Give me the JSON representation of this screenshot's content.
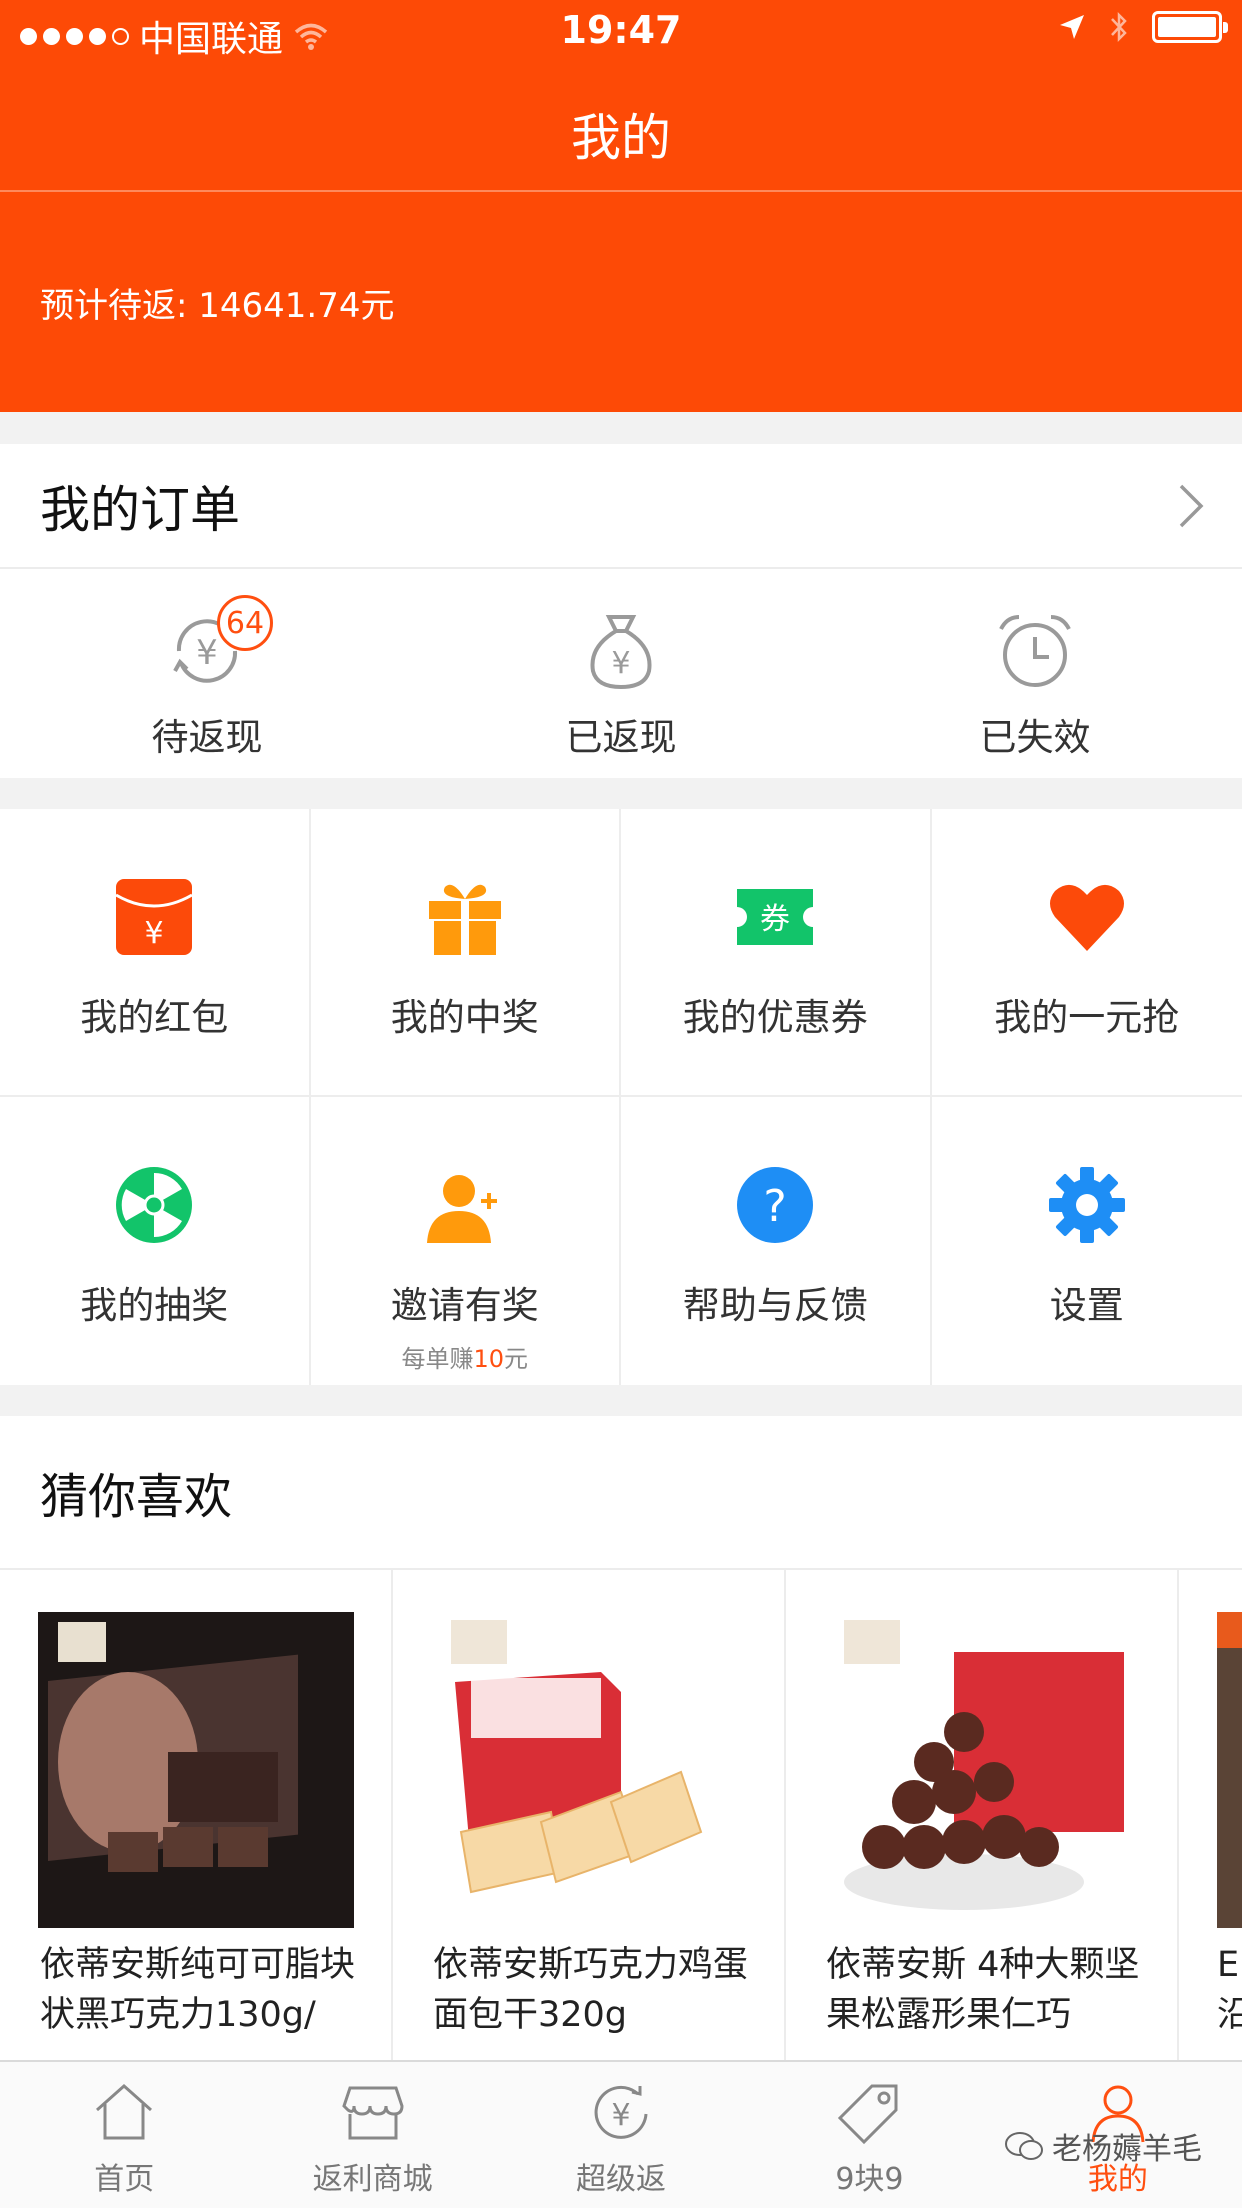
{
  "status_bar": {
    "carrier": "中国联通",
    "time": "19:47"
  },
  "nav": {
    "title": "我的"
  },
  "summary": {
    "pending_text": "预计待返: 14641.74元"
  },
  "orders": {
    "title": "我的订单",
    "items": [
      {
        "label": "待返现",
        "badge": "64"
      },
      {
        "label": "已返现"
      },
      {
        "label": "已失效"
      }
    ]
  },
  "grid": {
    "items": [
      {
        "label": "我的红包"
      },
      {
        "label": "我的中奖"
      },
      {
        "label": "我的优惠券",
        "icon_text": "券"
      },
      {
        "label": "我的一元抢"
      },
      {
        "label": "我的抽奖"
      },
      {
        "label": "邀请有奖",
        "sub_prefix": "每单赚",
        "sub_highlight": "10",
        "sub_suffix": "元"
      },
      {
        "label": "帮助与反馈",
        "icon_text": "?"
      },
      {
        "label": "设置"
      }
    ]
  },
  "recommend": {
    "title": "猜你喜欢",
    "products": [
      {
        "name": "依蒂安斯纯可可脂块状黑巧克力130g/"
      },
      {
        "name": "依蒂安斯巧克力鸡蛋面包干320g"
      },
      {
        "name": "依蒂安斯 4种大颗坚果松露形果仁巧"
      },
      {
        "name": "E…沿"
      }
    ]
  },
  "tabbar": {
    "items": [
      {
        "label": "首页"
      },
      {
        "label": "返利商城"
      },
      {
        "label": "超级返"
      },
      {
        "label": "9块9"
      },
      {
        "label": "我的"
      }
    ]
  },
  "watermark": {
    "text": "老杨薅羊毛"
  },
  "colors": {
    "brand": "#fd4a06",
    "accent": "#ff4f10"
  }
}
